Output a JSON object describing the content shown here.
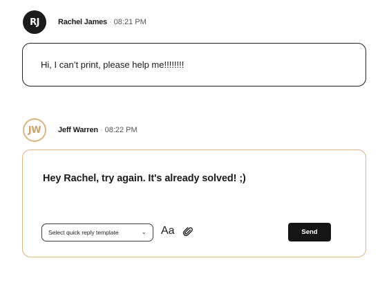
{
  "messages": [
    {
      "avatar_initials": "RJ",
      "author": "Rachel James",
      "separator": "·",
      "time": "08:21 PM",
      "text": "Hi, I can’t print, please help me!!!!!!!!"
    }
  ],
  "reply": {
    "avatar_initials": "JW",
    "author": "Jeff Warren",
    "separator": "·",
    "time": "08:22 PM",
    "draft_text": "Hey Rachel, try again. It's already solved! ;)",
    "template_select_value": "Select quick reply template",
    "font_label": "Aa",
    "send_label": "Send"
  },
  "colors": {
    "accent": "#d9b57f",
    "dark": "#1b1b1b"
  },
  "icons": {
    "chevron": "chevron-down-icon",
    "attach": "paperclip-icon"
  }
}
